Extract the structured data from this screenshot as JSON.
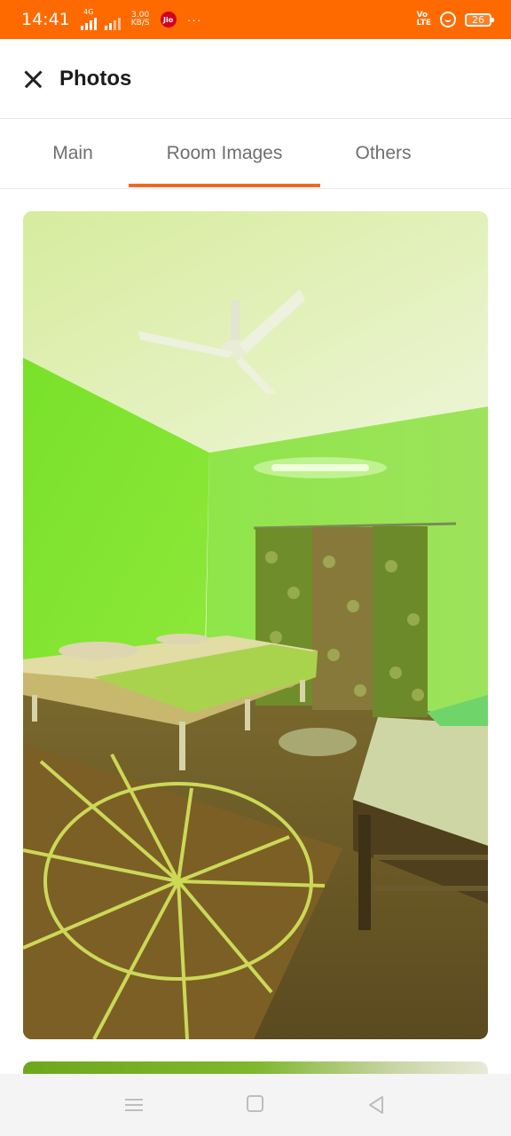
{
  "status_bar": {
    "time": "14:41",
    "network_tag": "4G",
    "speed_value": "3.00",
    "speed_unit": "KB/S",
    "carrier_badge": "Jio",
    "more_indicator": "···",
    "volte_top": "Vo",
    "volte_bottom": "LTE",
    "battery_level": "26",
    "background_color": "#ff6a00"
  },
  "header": {
    "title": "Photos",
    "close_icon": "close-icon"
  },
  "tabs": {
    "items": [
      {
        "label": "Main",
        "active": false
      },
      {
        "label": "Room Images",
        "active": true
      },
      {
        "label": "Others",
        "active": false
      }
    ],
    "active_color": "#ee6a24"
  },
  "gallery": {
    "photos": [
      {
        "subject": "room-photo-bedroom"
      },
      {
        "subject": "room-photo-next"
      }
    ]
  },
  "nav_bar": {
    "icons": [
      "menu-icon",
      "home-icon",
      "back-icon"
    ]
  }
}
